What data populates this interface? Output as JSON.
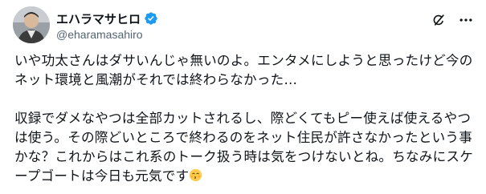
{
  "tweet": {
    "author": {
      "display_name": "エハラマサヒロ",
      "handle": "@eharamasahiro",
      "verified": true,
      "avatar_icon": "avatar-photo"
    },
    "actions": {
      "grok_icon": "grok-icon",
      "more_icon": "more-icon"
    },
    "paragraphs": [
      "いや功太さんはダサいんじゃ無いのよ。エンタメにしようと思ったけど今のネット環境と風潮がそれでは終わらなかった…",
      "収録でダメなやつは全部カットされるし、際どくてもピー使えば使えるやつは使う。その際どいところで終わるのをネット住民が許さなかったという事かな？これからはこれ系のトーク扱う時は気をつけないとね。ちなみにスケープゴートは今日も元気です"
    ],
    "trailing_emoji": "kissing-face-emoji"
  },
  "colors": {
    "text_primary": "#0f1419",
    "text_secondary": "#536471",
    "verified_blue": "#1d9bf0",
    "background": "#ffffff"
  }
}
